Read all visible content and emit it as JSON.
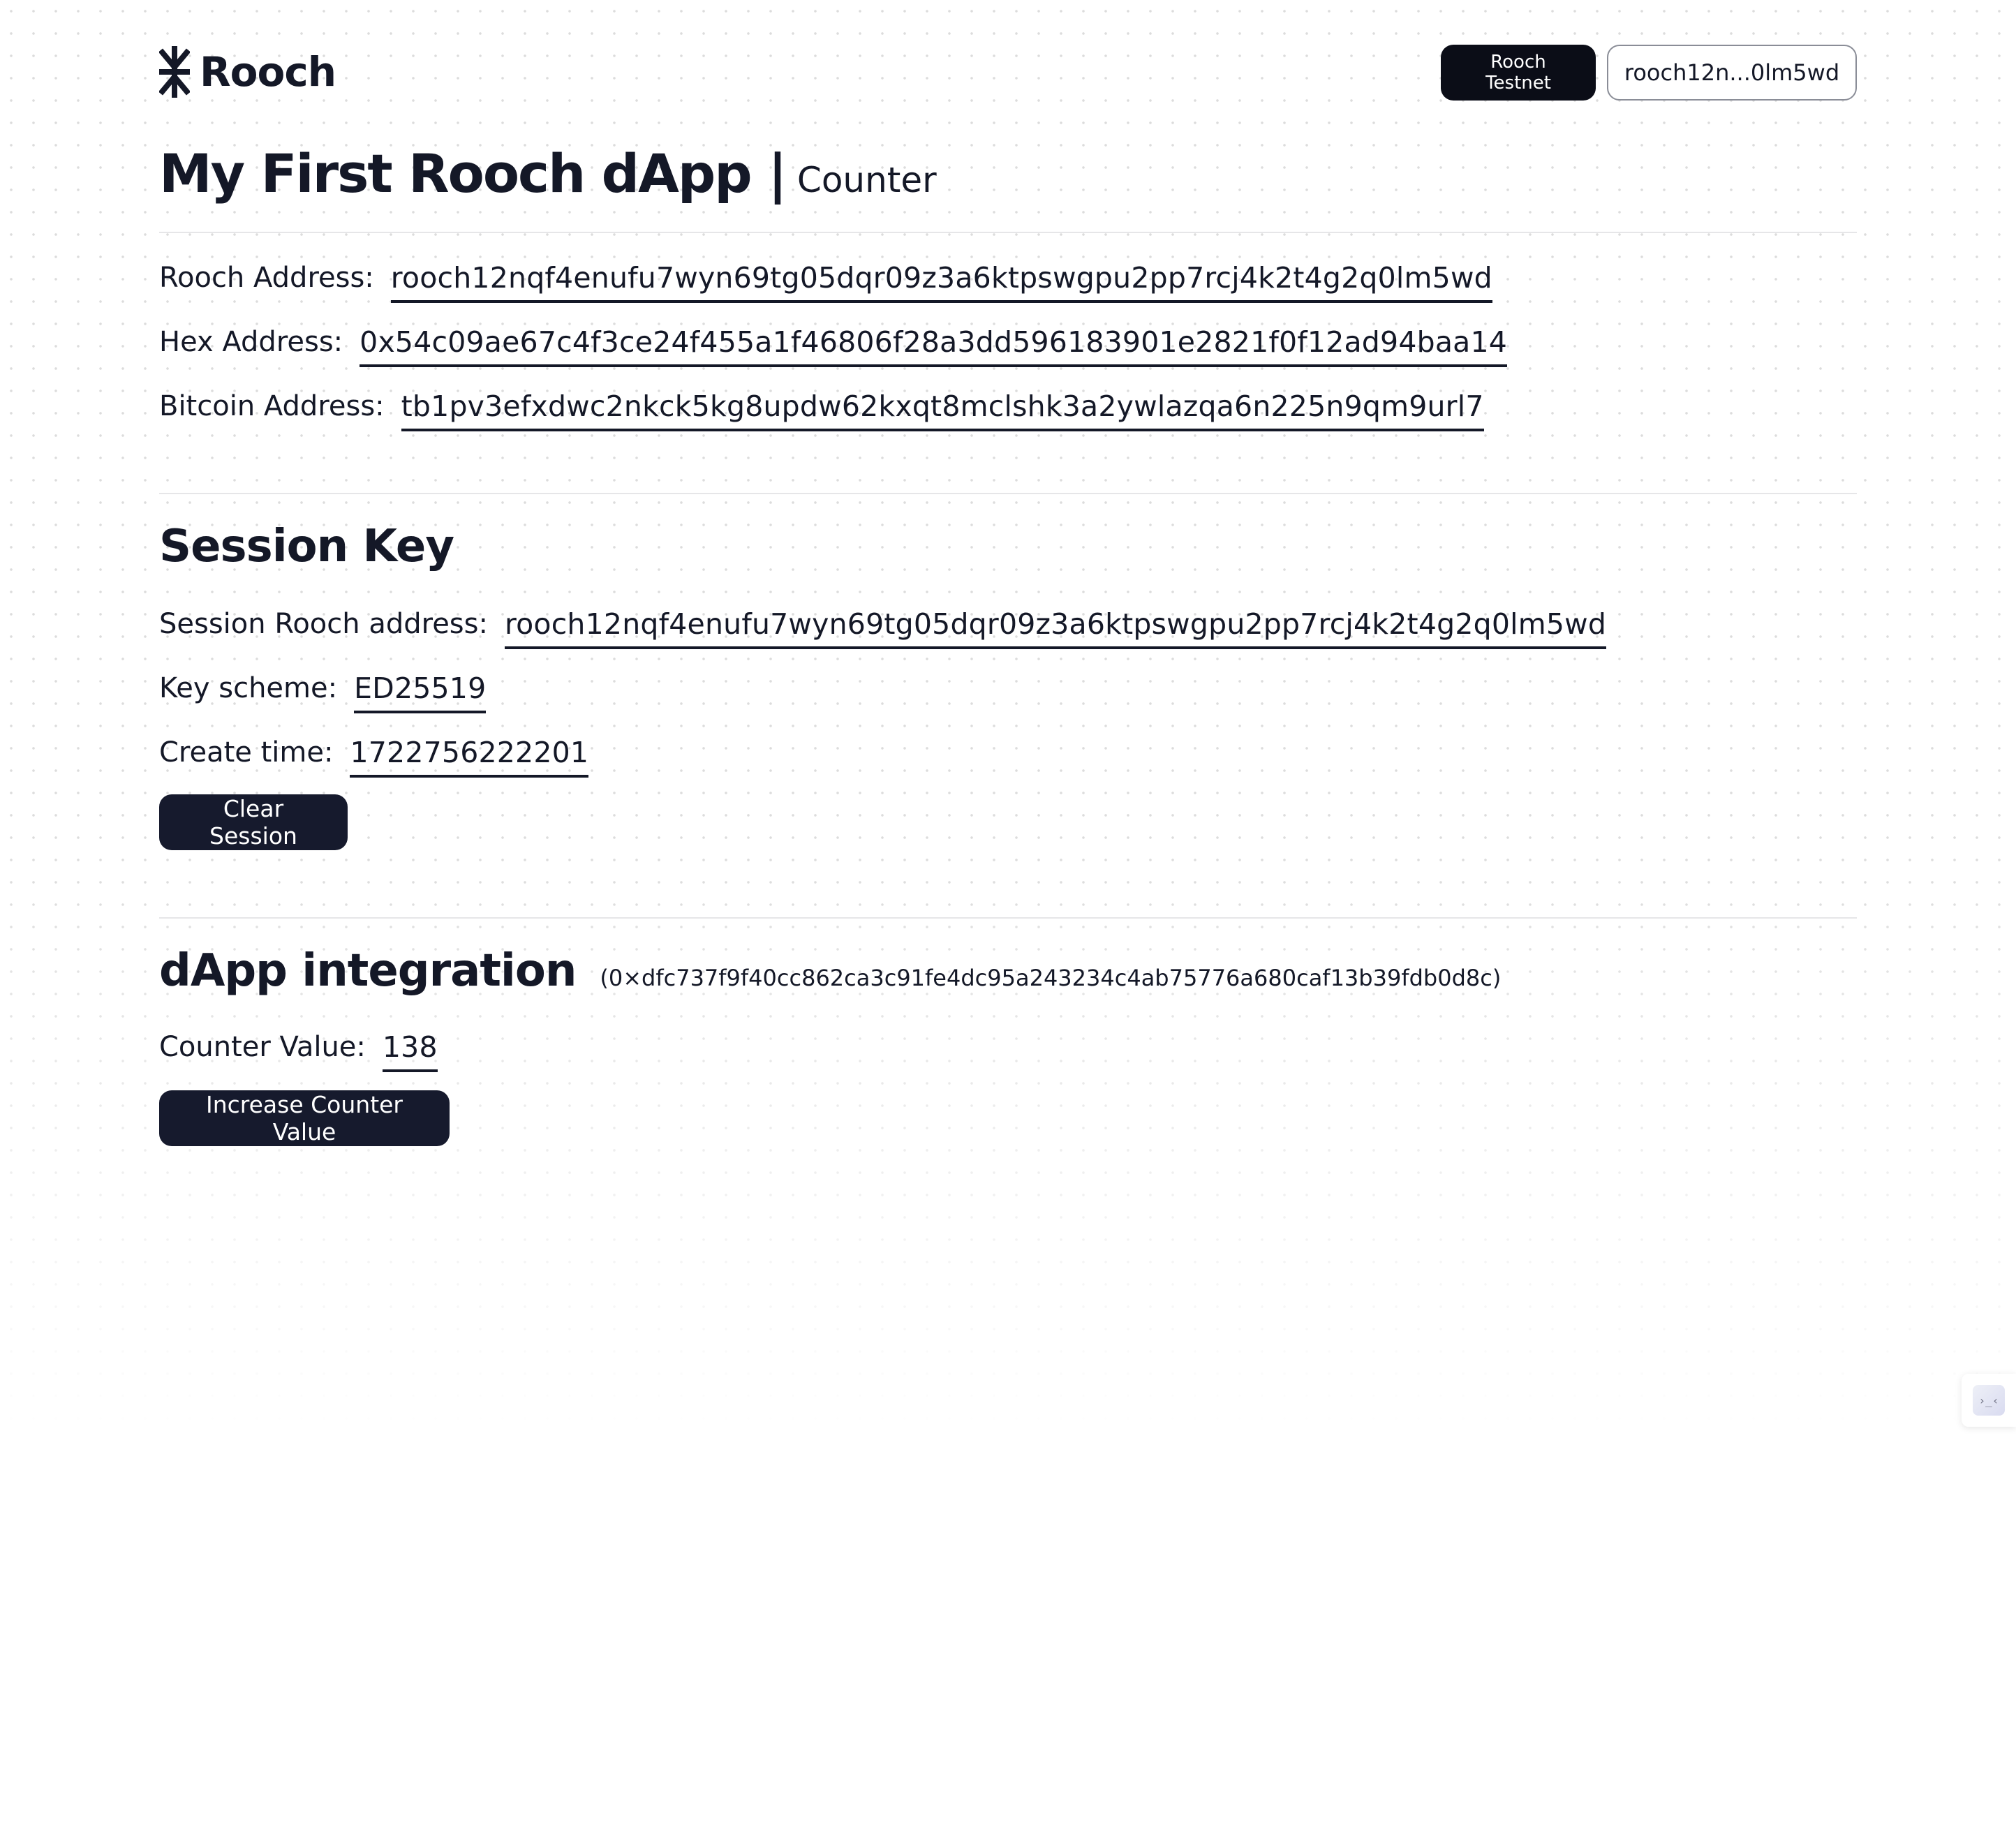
{
  "header": {
    "logo_text": "Rooch",
    "network_label": "Rooch Testnet",
    "wallet_label": "rooch12n...0lm5wd"
  },
  "title": {
    "main": "My First Rooch dApp |",
    "sub": "Counter"
  },
  "account": {
    "rooch_label": "Rooch Address:",
    "rooch_value": "rooch12nqf4enufu7wyn69tg05dqr09z3a6ktpswgpu2pp7rcj4k2t4g2q0lm5wd",
    "hex_label": "Hex Address:",
    "hex_value": "0x54c09ae67c4f3ce24f455a1f46806f28a3dd596183901e2821f0f12ad94baa14",
    "btc_label": "Bitcoin Address:",
    "btc_value": "tb1pv3efxdwc2nkck5kg8updw62kxqt8mclshk3a2ywlazqa6n225n9qm9url7"
  },
  "session": {
    "heading": "Session Key",
    "address_label": "Session Rooch address:",
    "address_value": "rooch12nqf4enufu7wyn69tg05dqr09z3a6ktpswgpu2pp7rcj4k2t4g2q0lm5wd",
    "scheme_label": "Key scheme:",
    "scheme_value": "ED25519",
    "time_label": "Create time:",
    "time_value": "1722756222201",
    "clear_button": "Clear Session"
  },
  "dapp": {
    "heading": "dApp integration",
    "contract_address": "(0×dfc737f9f40cc862ca3c91fe4dc95a243234c4ab75776a680caf13b39fdb0d8c)",
    "counter_label": "Counter Value:",
    "counter_value": "138",
    "increase_button": "Increase Counter Value"
  },
  "widget": {
    "glyph": "›_‹"
  }
}
